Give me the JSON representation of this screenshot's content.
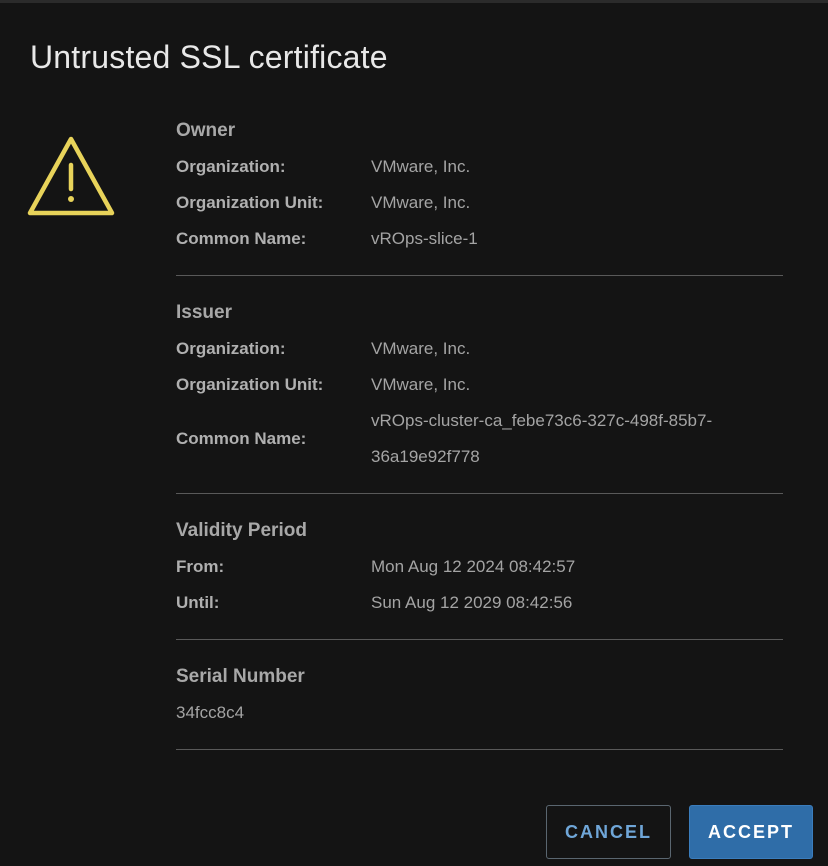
{
  "dialog": {
    "title": "Untrusted SSL certificate",
    "warning_icon": "warning-triangle-icon",
    "accent_color": "#e8d35a"
  },
  "sections": {
    "owner": {
      "title": "Owner",
      "organization_label": "Organization:",
      "organization_value": "VMware, Inc.",
      "org_unit_label": "Organization Unit:",
      "org_unit_value": "VMware, Inc.",
      "common_name_label": "Common Name:",
      "common_name_value": "vROps-slice-1"
    },
    "issuer": {
      "title": "Issuer",
      "organization_label": "Organization:",
      "organization_value": "VMware, Inc.",
      "org_unit_label": "Organization Unit:",
      "org_unit_value": "VMware, Inc.",
      "common_name_label": "Common Name:",
      "common_name_value": "vROps-cluster-ca_febe73c6-327c-498f-85b7-36a19e92f778"
    },
    "validity": {
      "title": "Validity Period",
      "from_label": "From:",
      "from_value": "Mon Aug 12 2024 08:42:57",
      "until_label": "Until:",
      "until_value": "Sun Aug 12 2029 08:42:56"
    },
    "serial": {
      "title": "Serial Number",
      "value": "34fcc8c4"
    }
  },
  "buttons": {
    "cancel_label": "CANCEL",
    "accept_label": "ACCEPT",
    "accept_color": "#2f6da8",
    "cancel_text_color": "#6fa6d8"
  }
}
